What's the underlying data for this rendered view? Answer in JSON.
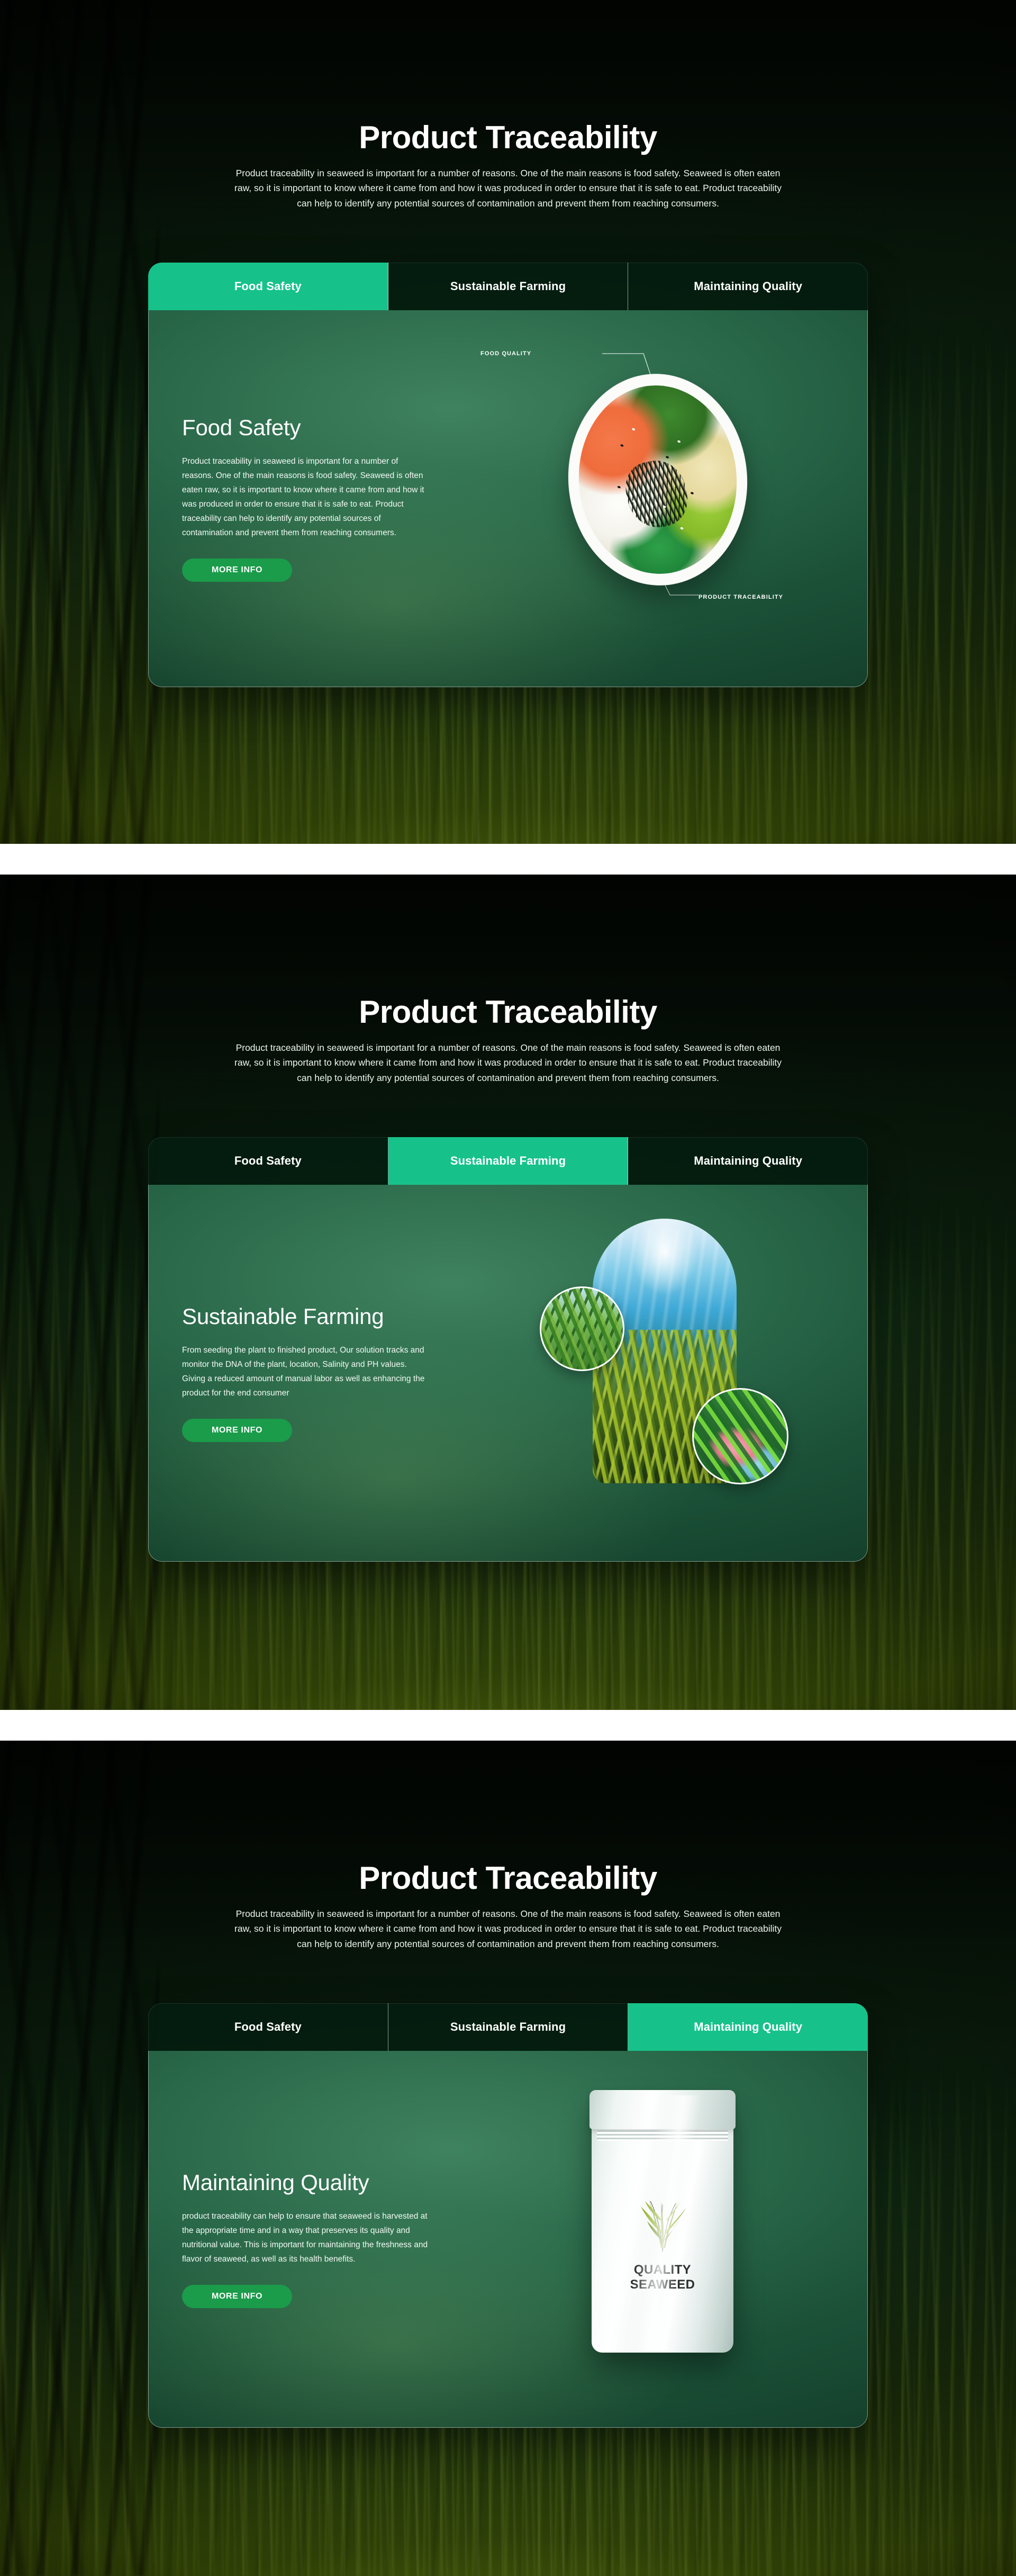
{
  "theme": {
    "accent": "#17c28a",
    "button": "#1a9c4a",
    "panel_green": "#2a6a4a",
    "text_white": "#ffffff"
  },
  "hero": {
    "title": "Product Traceability",
    "subtitle": "Product traceability in seaweed is important for a number of reasons. One of the main reasons is food safety. Seaweed is often eaten raw, so it is important to know where it came from and how it was produced in order to ensure that it is safe to eat. Product traceability can help to identify any potential sources of contamination and prevent them from reaching consumers."
  },
  "tabs": [
    {
      "label": "Food Safety"
    },
    {
      "label": "Sustainable Farming"
    },
    {
      "label": "Maintaining Quality"
    }
  ],
  "sections": [
    {
      "active_tab_index": 0,
      "panel": {
        "title": "Food Safety",
        "description": "Product traceability in seaweed is important for a number of reasons. One of the main reasons is food safety. Seaweed is often eaten raw, so it is important to know where it came from and how it was produced in order to ensure that it is safe to eat. Product traceability can help to identify any potential sources of contamination and prevent them from reaching consumers.",
        "button_label": "MORE INFO",
        "media_type": "poke-bowl-photo",
        "annotations": [
          {
            "label": "FOOD QUALITY"
          },
          {
            "label": "PRODUCT TRACEABILITY"
          }
        ]
      }
    },
    {
      "active_tab_index": 1,
      "panel": {
        "title": "Sustainable Farming",
        "description": "From seeding the plant to finished product, Our solution tracks and monitor the DNA of the plant, location, Salinity and PH values. Giving a reduced amount of manual labor as well as enhancing the product for the end consumer",
        "button_label": "MORE INFO",
        "media_type": "underwater-seaweed-collage"
      }
    },
    {
      "active_tab_index": 2,
      "panel": {
        "title": "Maintaining Quality",
        "description": "product traceability can help to ensure that seaweed is harvested at the appropriate time and in a way that preserves its quality and nutritional value. This is important for maintaining the freshness and flavor of seaweed, as well as its health benefits.",
        "button_label": "MORE INFO",
        "media_type": "product-pouch-photo",
        "product_package": {
          "line1": "QUALITY",
          "line2": "SEAWEED"
        }
      }
    }
  ]
}
